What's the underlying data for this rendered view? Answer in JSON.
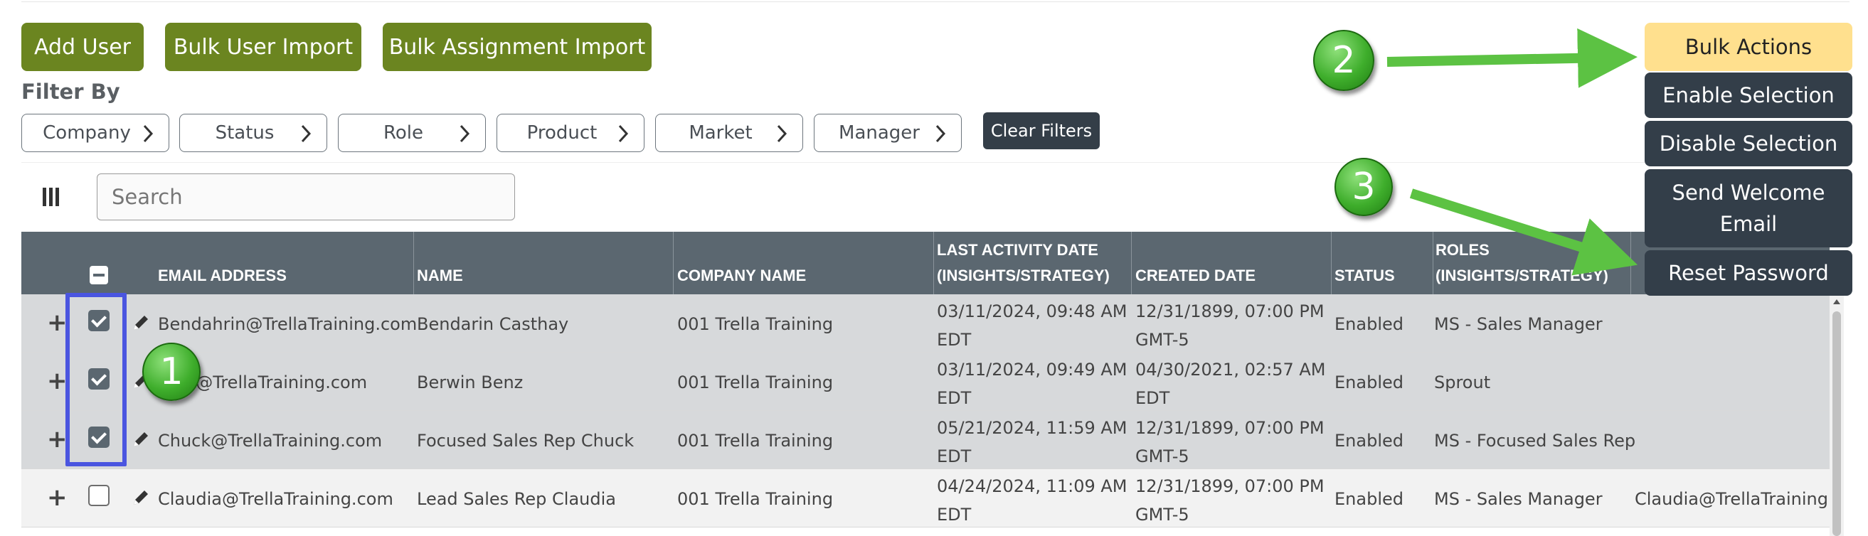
{
  "toolbar": {
    "add_user": "Add User",
    "bulk_user_import": "Bulk User Import",
    "bulk_assignment_import": "Bulk Assignment Import"
  },
  "filters": {
    "title": "Filter By",
    "items": [
      "Company",
      "Status",
      "Role",
      "Product",
      "Market",
      "Manager"
    ],
    "clear": "Clear Filters"
  },
  "search": {
    "placeholder": "Search",
    "value": ""
  },
  "table": {
    "headers": {
      "email": "EMAIL ADDRESS",
      "name": "NAME",
      "company": "COMPANY NAME",
      "last_activity_1": "LAST ACTIVITY DATE",
      "last_activity_2": "(INSIGHTS/STRATEGY)",
      "created": "CREATED DATE",
      "status": "STATUS",
      "roles_1": "ROLES",
      "roles_2": "(INSIGHTS/STRATEGY)"
    },
    "rows": [
      {
        "email": "Bendahrin@TrellaTraining.com",
        "name": "Bendarin Casthay",
        "company": "001 Trella Training",
        "last1": "03/11/2024, 09:48 AM",
        "last2": "EDT",
        "created1": "12/31/1899, 07:00 PM",
        "created2": "GMT-5",
        "status": "Enabled",
        "role": "MS - Sales Manager",
        "extra": "",
        "checked": true
      },
      {
        "email": "n@TrellaTraining.com",
        "name": "Berwin Benz",
        "company": "001 Trella Training",
        "last1": "03/11/2024, 09:49 AM",
        "last2": "EDT",
        "created1": "04/30/2021, 02:57 AM",
        "created2": "EDT",
        "status": "Enabled",
        "role": "Sprout",
        "extra": "",
        "checked": true
      },
      {
        "email": "Chuck@TrellaTraining.com",
        "name": "Focused Sales Rep Chuck",
        "company": "001 Trella Training",
        "last1": "05/21/2024, 11:59 AM",
        "last2": "EDT",
        "created1": "12/31/1899, 07:00 PM",
        "created2": "GMT-5",
        "status": "Enabled",
        "role": "MS - Focused Sales Rep",
        "extra": "",
        "checked": true
      },
      {
        "email": "Claudia@TrellaTraining.com",
        "name": "Lead Sales Rep Claudia",
        "company": "001 Trella Training",
        "last1": "04/24/2024, 11:09 AM",
        "last2": "EDT",
        "created1": "12/31/1899, 07:00 PM",
        "created2": "GMT-5",
        "status": "Enabled",
        "role": "MS - Sales Manager",
        "extra": "Claudia@TrellaTraining.cc",
        "checked": false
      }
    ]
  },
  "bulk_actions": {
    "label": "Bulk Actions",
    "items": [
      "Enable Selection",
      "Disable Selection",
      "Send Welcome Email",
      "Reset Password"
    ]
  },
  "annotations": {
    "badge1": "1",
    "badge2": "2",
    "badge3": "3"
  },
  "colors": {
    "green_button": "#6b8520",
    "bulk_actions": "#ffe08e",
    "menu_item": "#333e49",
    "table_header": "#5b6770",
    "highlight_box": "#4a55e0",
    "arrow_green": "#5cc243"
  }
}
